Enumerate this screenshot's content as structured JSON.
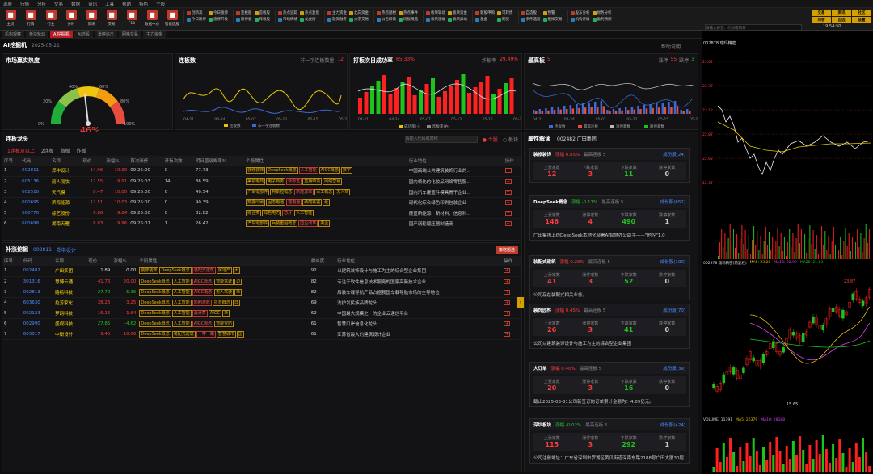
{
  "menubar": [
    "选股",
    "行情",
    "分析",
    "交易",
    "数据",
    "资讯",
    "工具",
    "帮助",
    "特色",
    "个股"
  ],
  "toolbar": {
    "buttons": [
      {
        "label": "主页",
        "color": "#c0392b",
        "icon": "home-icon"
      },
      {
        "label": "行情",
        "color": "#c0392b",
        "icon": "chart-icon"
      },
      {
        "label": "行业",
        "color": "#c0392b",
        "icon": "grid-icon"
      },
      {
        "label": "分时",
        "color": "#c0392b",
        "icon": "clock-icon"
      },
      {
        "label": "资讯",
        "color": "#c0392b",
        "icon": "news-icon"
      },
      {
        "label": "交易",
        "color": "#c0392b",
        "icon": "trade-icon"
      },
      {
        "label": "F10",
        "color": "#c0392b",
        "icon": "info-icon"
      },
      {
        "label": "数据中心",
        "color": "#c0392b",
        "icon": "db-icon"
      },
      {
        "label": "智能选股",
        "color": "#c0392b",
        "icon": "ai-icon"
      }
    ],
    "groups": [
      [
        "创新高",
        "今日涨停",
        "今日跌停",
        "涨停开板"
      ],
      [
        "连板股",
        "首板股",
        "跌停板",
        "炸板股"
      ],
      [
        "热点追踪",
        "热点复盘",
        "市场情绪",
        "龙虎榜"
      ],
      [
        "主力资金",
        "北向资金",
        "融资融券",
        "大宗交易"
      ],
      [
        "热点题材",
        "热点事件",
        "公告解读",
        "研报精选"
      ],
      [
        "板块轮动",
        "板块资金",
        "板块涨幅",
        "板块异动"
      ],
      [
        "新股申购",
        "可转债",
        "基金",
        "期货"
      ],
      [
        "自选股",
        "预警",
        "条件选股",
        "模拟交易"
      ],
      [
        "股东分析",
        "财务分析",
        "机构评级",
        "盈利预测"
      ]
    ],
    "brand": [
      "交易",
      "资讯",
      "社区",
      "问答",
      "自选",
      "设置"
    ]
  },
  "tabs": [
    "机构观察",
    "板块轮动",
    "AI挖掘机",
    "AI选股",
    "涨停追击",
    "网格交易",
    "主力资金"
  ],
  "page": {
    "title": "AI挖掘机",
    "date": "2025-05-21",
    "help": "帮助说明"
  },
  "heat": {
    "title": "市场赢实热度",
    "value": "46%",
    "ticks": [
      "0%",
      "20%",
      "40%",
      "60%",
      "80%",
      "100%"
    ]
  },
  "lianban": {
    "title": "连板数",
    "sub": "非一字连板数量",
    "sub_value": "12",
    "legend": [
      "连板数",
      "非一字连板数"
    ],
    "x": [
      "04-21",
      "04-24",
      "05-07",
      "05-12",
      "05-15",
      "05-21"
    ]
  },
  "dapan": {
    "title": "打板次日成功率",
    "rate": "65.33%",
    "right": "炸板率",
    "right_value": "29.49%",
    "legend": [
      "成功率(-)",
      "炸板率(右)"
    ],
    "x": [
      "04-21",
      "04-24",
      "05-07",
      "05-12",
      "05-15",
      "05-21"
    ]
  },
  "zuigao": {
    "title": "最高板",
    "value": "5",
    "right1": "涨停",
    "right1_value": "55",
    "right2": "跌停",
    "right2_value": "3",
    "legend": [
      "连板数",
      "最高连板",
      "涨停家数",
      "跌停家数"
    ],
    "x": [
      "04-21",
      "04-24",
      "05-07",
      "05-12",
      "05-15",
      "05-21"
    ]
  },
  "lianban_table": {
    "title": "连板龙头",
    "search_placeholder": "请输入代码或简称",
    "radio1": "个股",
    "radio2": "板块",
    "filters": [
      "1连板及以上",
      "2连板",
      "首板",
      "炸板"
    ],
    "headers": [
      "序号",
      "代码",
      "名称",
      "现价",
      "涨幅%",
      "首次涨停",
      "开板次数",
      "明日晋级概率%",
      "个股属性",
      "行业地位",
      "操作"
    ],
    "rows": [
      {
        "n": "1",
        "code": "002811",
        "name": "郑中设计",
        "price": "14.96",
        "chg": "10.00",
        "time": "09:25:00",
        "open": "0",
        "prob": "77.73",
        "tags": [
          "装修装饰",
          "DeepSeek概念",
          "人工智能",
          "AIGC概念",
          "数字"
        ],
        "desc": "中国高端公共建筑装饰行业的..."
      },
      {
        "n": "2",
        "code": "605136",
        "name": "丽人丽妆",
        "price": "12.55",
        "chg": "9.91",
        "time": "09:25:03",
        "open": "14",
        "prob": "36.59",
        "tags": [
          "美妆电商",
          "电子商务",
          "新零售",
          "直播带货",
          "网络营销"
        ],
        "desc": "国内领先的化妆品网络零售服..."
      },
      {
        "n": "3",
        "code": "002510",
        "name": "天汽模",
        "price": "8.47",
        "chg": "10.00",
        "time": "09:25:00",
        "open": "0",
        "prob": "40.54",
        "tags": [
          "汽车零部件",
          "特斯拉概念",
          "新能源车",
          "军工概念",
          "无人驾"
        ],
        "desc": "国内汽车覆盖件模具骨干企业..."
      },
      {
        "n": "4",
        "code": "000695",
        "code2": "",
        "name": "滨海能源",
        "price": "12.51",
        "chg": "10.03",
        "time": "09:25:00",
        "open": "0",
        "prob": "90.39",
        "tags": [
          "数据印刷",
          "固态电池",
          "锂电池",
          "磷酸铁锂",
          "纸"
        ],
        "desc": "现代化综合绿色印刷包装企业"
      },
      {
        "n": "5",
        "code": "600770",
        "name": "综艺股份",
        "price": "6.86",
        "chg": "9.84",
        "time": "09:25:00",
        "open": "0",
        "prob": "82.82",
        "tags": [
          "综合类",
          "绿色电力",
          "芯片",
          "人工智能"
        ],
        "desc": "覆盖新能源、新材料、信息科..."
      },
      {
        "n": "6",
        "code": "600698",
        "name": "湖南天雁",
        "price": "8.83",
        "chg": "9.96",
        "time": "09:25:01",
        "open": "1",
        "prob": "26.42",
        "tags": [
          "汽车零部件",
          "兵装重组概念",
          "国企改革",
          "央企"
        ],
        "desc": "国产涡轮增压器制造商"
      }
    ]
  },
  "buzhang": {
    "title": "补涨挖掘",
    "code": "002811",
    "name": "郑中设计",
    "button": "策略题选",
    "headers": [
      "序号",
      "代码",
      "名称",
      "现价",
      "涨幅%",
      "个股属性",
      "相似度",
      "行业地位",
      "操作"
    ],
    "rows": [
      {
        "n": "1",
        "code": "002482",
        "name": "广田集团",
        "price": "1.89",
        "chg": "0.00",
        "tags": [
          "装修装饰",
          "DeepSeek概念",
          "装配式建筑",
          "房地产",
          "大"
        ],
        "sim": "92",
        "desc": "以建筑装饰设计与施工为主的综合型企业集团"
      },
      {
        "n": "2",
        "code": "301316",
        "name": "慧博云通",
        "price": "41.76",
        "chg": "20.00",
        "tags": [
          "DeepSeek概念",
          "人工智能",
          "AIGC概念",
          "智能驾驶",
          "边"
        ],
        "sim": "82",
        "desc": "专注于软件信息技术服务的国家高新技术企业"
      },
      {
        "n": "3",
        "code": "002813",
        "name": "路畅科技",
        "price": "27.70",
        "chg": "-5.36",
        "tags": [
          "DeepSeek概念",
          "人工智能",
          "AIGC概念",
          "无人驾驶",
          "华"
        ],
        "sim": "82",
        "desc": "后装车载导航产品占据我国车载导航市场的主导地位"
      },
      {
        "n": "4",
        "code": "603630",
        "name": "拉芳家化",
        "price": "28.26",
        "chg": "3.25",
        "tags": [
          "DeepSeek概念",
          "人工智能",
          "短剧游戏",
          "抖音概念",
          "日"
        ],
        "sim": "69",
        "desc": "洗护发民族品牌龙头"
      },
      {
        "n": "5",
        "code": "002123",
        "name": "梦网科技",
        "price": "16.16",
        "chg": "1.64",
        "tags": [
          "DeepSeek概念",
          "人工智能",
          "云计算",
          "AIGC",
          "华"
        ],
        "sim": "62",
        "desc": "中国最大规模之一的企业云通信平台"
      },
      {
        "n": "6",
        "code": "002990",
        "name": "盛视科技",
        "price": "27.85",
        "chg": "-4.62",
        "tags": [
          "DeepSeek概念",
          "人工智能",
          "AIGC概念",
          "智能安防"
        ],
        "sim": "61",
        "desc": "智慧口岸信息化龙头"
      },
      {
        "n": "7",
        "code": "603017",
        "name": "中衡设计",
        "price": "9.45",
        "chg": "10.06",
        "tags": [
          "DeepSeek概念",
          "装配式建筑",
          "一带一路",
          "智慧城市",
          "国"
        ],
        "sim": "61",
        "desc": "江苏省最大的建筑设计企业"
      }
    ]
  },
  "attr": {
    "title": "属性解读",
    "stock": "002482 广田集团"
  },
  "sectors": [
    {
      "name": "装修装饰",
      "chg": "涨幅 0.85%",
      "lb": "最高连板 5",
      "link": "成份股(24)",
      "s1": "上涨家数",
      "v1": "12",
      "s2": "下跌家数",
      "v2": "3",
      "s3": "下跌家数",
      "v3": "11",
      "s4": "跌停家数",
      "v4": "0",
      "note": ""
    },
    {
      "name": "DeepSeek概念",
      "chg": "涨幅 -0.17%",
      "lb": "最高连板 5",
      "link": "成份股(651)",
      "s1": "上涨家数",
      "v1": "146",
      "s2": "涨停家数",
      "v2": "4",
      "s3": "下跌家数",
      "v3": "490",
      "s4": "跌停家数",
      "v4": "1",
      "note": "广田集团上线DeepSeek本地化部署AI智慧办公助手——\"他控\"1.0"
    },
    {
      "name": "装配式建筑",
      "chg": "涨幅 0.29%",
      "lb": "最高连板 5",
      "link": "成份股(100)",
      "s1": "上涨家数",
      "v1": "41",
      "s2": "涨停家数",
      "v2": "3",
      "s3": "下跌家数",
      "v3": "52",
      "s4": "跌停家数",
      "v4": "0",
      "note": "公司存在装配式相关业务。"
    },
    {
      "name": "装饰园林",
      "chg": "涨幅 0.45%",
      "lb": "最高连板 5",
      "link": "成份股(70)",
      "s1": "上涨家数",
      "v1": "26",
      "s2": "涨停家数",
      "v2": "3",
      "s3": "下跌家数",
      "v3": "41",
      "s4": "跌停家数",
      "v4": "0",
      "note": "公司以建筑装饰设计与施工为主的综合型企业集团"
    },
    {
      "name": "大订单",
      "chg": "涨幅 0.40%",
      "lb": "最高连板 5",
      "link": "成份股(39)",
      "s1": "上涨家数",
      "v1": "20",
      "s2": "涨停家数",
      "v2": "3",
      "s3": "下跌家数",
      "v3": "16",
      "s4": "跌停家数",
      "v4": "0",
      "note": "截止2025-03-31公司新签订的订单累计金额为：4.09亿元。"
    },
    {
      "name": "深圳板块",
      "chg": "涨幅 -0.02%",
      "lb": "最高连板 5",
      "link": "成份股(424)",
      "s1": "上涨家数",
      "v1": "115",
      "s2": "涨停家数",
      "v2": "3",
      "s3": "下跌家数",
      "v3": "292",
      "s4": "跌停家数",
      "v4": "1",
      "note": "公司注册地址：广东省深圳市罗湖区黄贝街道深南东路2188号广田大厦30层"
    }
  ],
  "right_panel": {
    "header": "002878 瑞玛精密",
    "search_placeholder": "请输入拼音、代码或简称",
    "time": "19:54:50",
    "intraday_prices": [
      "23.62",
      "23.37",
      "23.12",
      "22.87",
      "22.62",
      "22.37"
    ],
    "kline_header": "002978 瑞玛精密(前复权)",
    "ma_labels": [
      "MA5: 23.28",
      "MA10: 22.99",
      "MA20: 21.83"
    ],
    "kline_high": "23.87",
    "kline_low": "15.65",
    "vol_label": "VOLUME: 11391",
    "vol_ma": [
      "MA5: 26379",
      "MA10: 28188"
    ]
  },
  "colors": {
    "accent": "#b81c22",
    "up": "#ff3b3b",
    "down": "#1ec41e",
    "gold": "#e8b400"
  }
}
